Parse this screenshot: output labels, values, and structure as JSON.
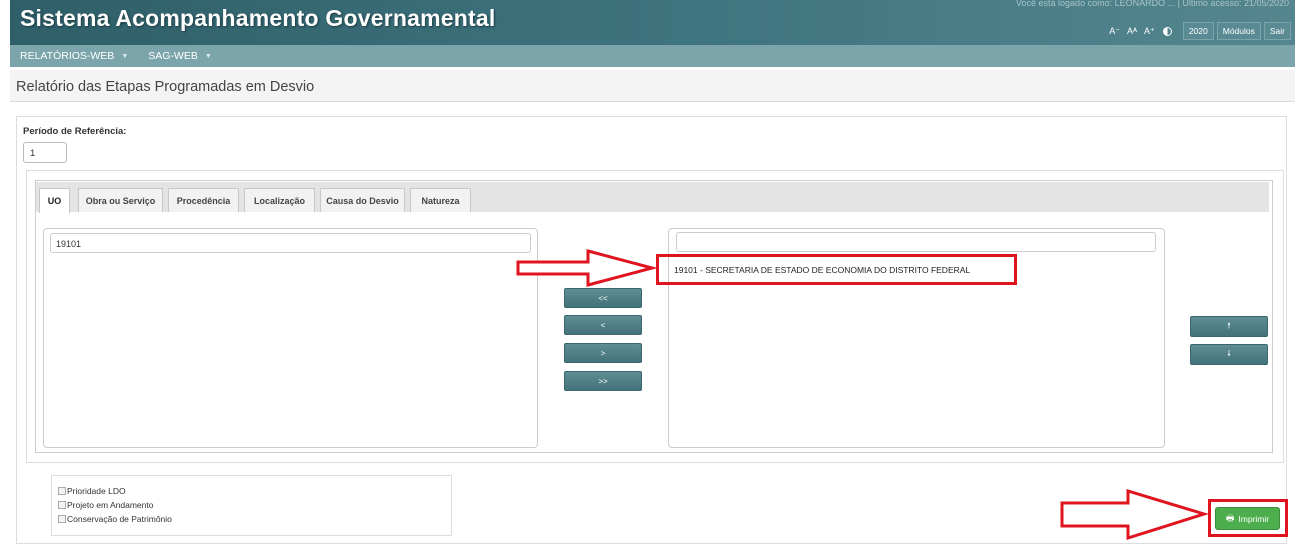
{
  "header": {
    "title": "Sistema Acompanhamento Governamental",
    "user_info": "Você está logado como: LEONARDO ... | Último acesso: 21/05/2020",
    "font_decrease": "A⁻",
    "font_reset": "Aᴬ",
    "font_increase": "A⁺",
    "year_button": "2020",
    "modules_button": "Módulos",
    "exit_button": "Sair"
  },
  "menu": {
    "items": [
      {
        "label": "RELATÓRIOS-WEB"
      },
      {
        "label": "SAG-WEB"
      }
    ]
  },
  "page": {
    "title": "Relatório das Etapas Programadas em Desvio"
  },
  "form": {
    "period_label": "Período de Referência:",
    "period_value": "1"
  },
  "tabs": [
    {
      "label": "UO",
      "active": true
    },
    {
      "label": "Obra ou Serviço"
    },
    {
      "label": "Procedência"
    },
    {
      "label": "Localização"
    },
    {
      "label": "Causa do Desvio"
    },
    {
      "label": "Natureza"
    }
  ],
  "left_list": {
    "filter_value": "19101",
    "items": []
  },
  "right_list": {
    "filter_value": "",
    "items": [
      "19101 - SECRETARIA DE ESTADO DE ECONOMIA DO DISTRITO FEDERAL"
    ]
  },
  "transfer_buttons": {
    "remove_all": "<<",
    "remove_one": "<",
    "add_one": ">",
    "add_all": ">>"
  },
  "order_buttons": {
    "up": "🠕",
    "down": "🠗"
  },
  "options": [
    {
      "label": "Prioridade LDO",
      "checked": false
    },
    {
      "label": "Projeto em Andamento",
      "checked": false
    },
    {
      "label": "Conservação de Patrimônio",
      "checked": false
    }
  ],
  "print_button": {
    "label": "Imprimir",
    "icon": "printer-icon"
  },
  "colors": {
    "header": "#3f7580",
    "menu": "#7ba4ab",
    "button": "#4f7f86",
    "print": "#4cae4c",
    "highlight": "#e0141e"
  }
}
